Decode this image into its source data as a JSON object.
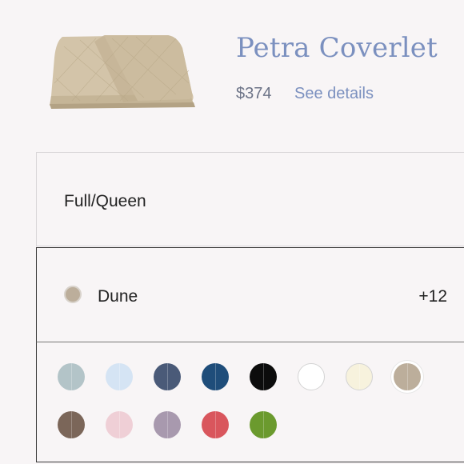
{
  "product": {
    "title": "Petra Coverlet",
    "price": "$374",
    "details_link": "See details"
  },
  "size_selector": {
    "selected": "Full/Queen"
  },
  "color_selector": {
    "selected": "Dune",
    "selected_color": "#bcae9b",
    "more_count": "+12"
  },
  "swatches": [
    {
      "name": "light-blue-gray",
      "color": "#b3c4c8"
    },
    {
      "name": "pale-blue",
      "color": "#d5e4f4"
    },
    {
      "name": "slate-navy",
      "color": "#4a5a78"
    },
    {
      "name": "navy-blue",
      "color": "#1f4d7a"
    },
    {
      "name": "black",
      "color": "#0c0c0c"
    },
    {
      "name": "white",
      "color": "#ffffff"
    },
    {
      "name": "ivory",
      "color": "#f7f2dd"
    },
    {
      "name": "dune",
      "color": "#bcae9b"
    },
    {
      "name": "brown",
      "color": "#7b6659"
    },
    {
      "name": "blush-pink",
      "color": "#efcfd6"
    },
    {
      "name": "lavender-gray",
      "color": "#a899ae"
    },
    {
      "name": "red",
      "color": "#d9565d"
    },
    {
      "name": "green",
      "color": "#6b9a2e"
    }
  ],
  "colors": {
    "accent": "#7b90bf",
    "text": "#222222",
    "price": "#6c7387"
  }
}
